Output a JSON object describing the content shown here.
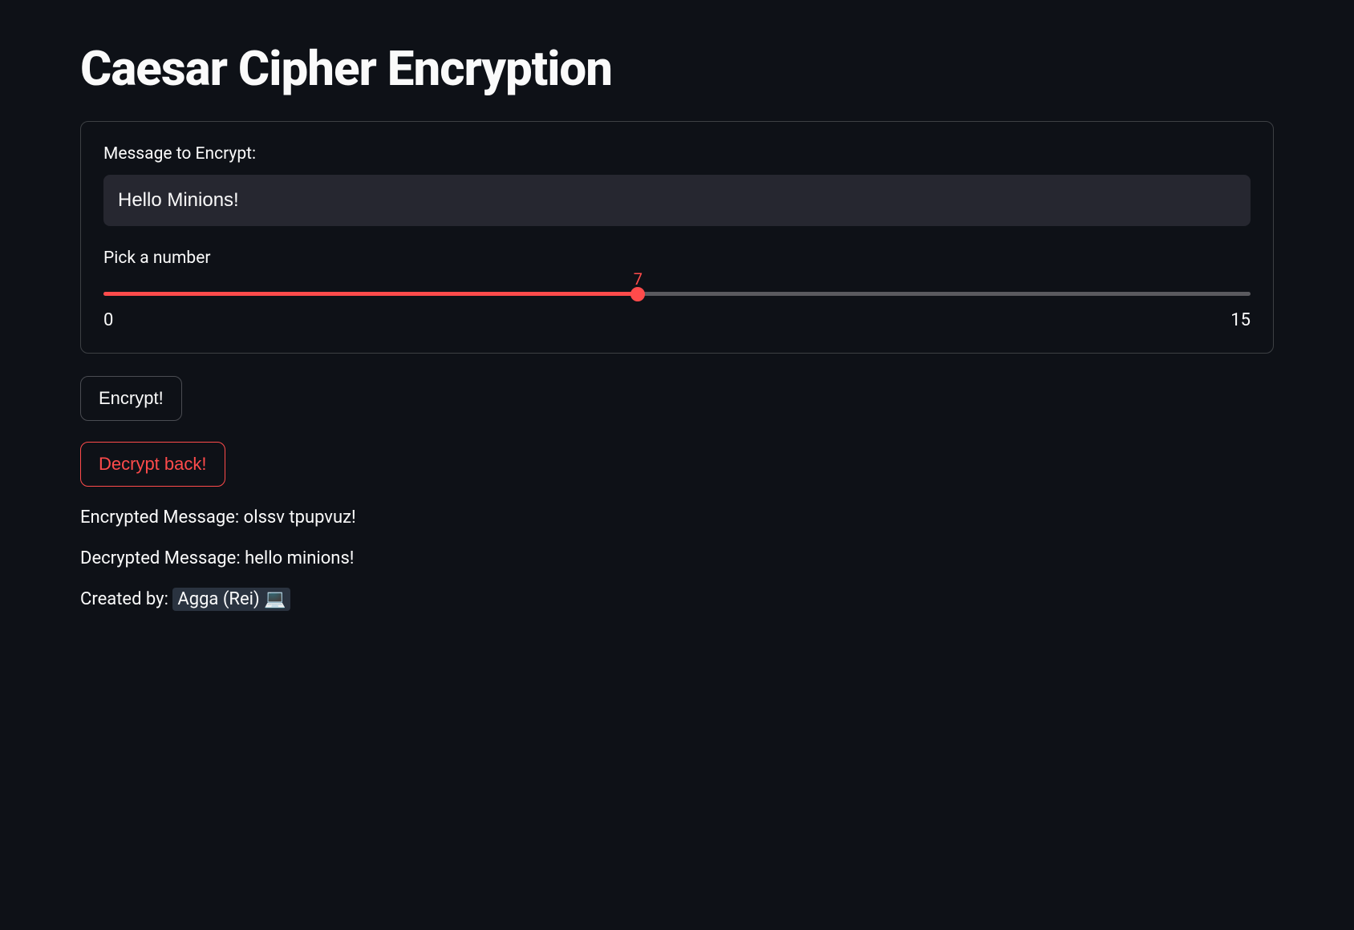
{
  "page": {
    "title": "Caesar Cipher Encryption"
  },
  "form": {
    "message_label": "Message to Encrypt:",
    "message_value": "Hello Minions!",
    "slider_label": "Pick a number",
    "slider_value": "7",
    "slider_min": "0",
    "slider_max": "15"
  },
  "buttons": {
    "encrypt_label": "Encrypt!",
    "decrypt_label": "Decrypt back!"
  },
  "results": {
    "encrypted_label": "Encrypted Message: ",
    "encrypted_value": "olssv tpupvuz!",
    "decrypted_label": "Decrypted Message: ",
    "decrypted_value": "hello minions!"
  },
  "credit": {
    "prefix": "Created by: ",
    "author": "Agga (Rei) 💻"
  }
}
